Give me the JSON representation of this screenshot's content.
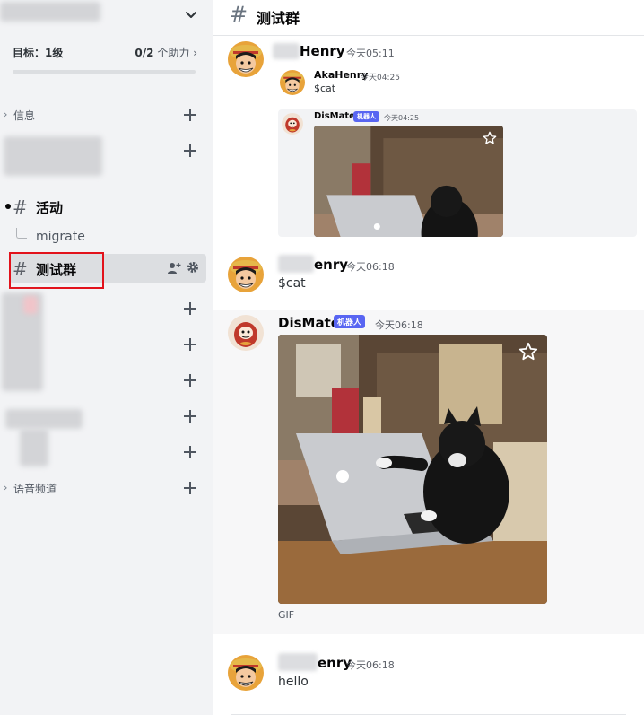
{
  "sidebar": {
    "boost_goal": "目标：1级",
    "boost_count": "0/2",
    "boost_suffix": "个助力",
    "boost_progress": 0,
    "categories": {
      "info": "信息",
      "voice": "语音频道"
    },
    "channels": {
      "activity": "活动",
      "thread": "migrate",
      "test_group": "测试群"
    }
  },
  "header": {
    "channel_name": "测试群"
  },
  "messages": [
    {
      "author_visible": "Henry",
      "time": "今天05:11",
      "reply": {
        "author": "AkaHenry",
        "time": "今天04:25",
        "text": "$cat"
      },
      "reply_bot": {
        "author": "DisMate",
        "bot_tag": "机器人",
        "time": "今天04:25"
      }
    },
    {
      "author_visible": "enry",
      "time": "今天06:18",
      "text": "$cat"
    },
    {
      "author": "DisMate",
      "bot_tag": "机器人",
      "time": "今天06:18",
      "gif_label": "GIF"
    },
    {
      "author_visible": "enry",
      "time": "今天06:18",
      "text": "hello"
    }
  ],
  "icons": {
    "server_menu": "chevron-down-icon",
    "add": "plus-icon",
    "channel": "hashtag-icon",
    "invite": "add-member-icon",
    "settings": "gear-icon",
    "favorite": "star-icon"
  },
  "colors": {
    "bot_tag": "#5865f2",
    "highlight_box": "#e2121b",
    "sidebar_bg": "#f2f3f5"
  }
}
